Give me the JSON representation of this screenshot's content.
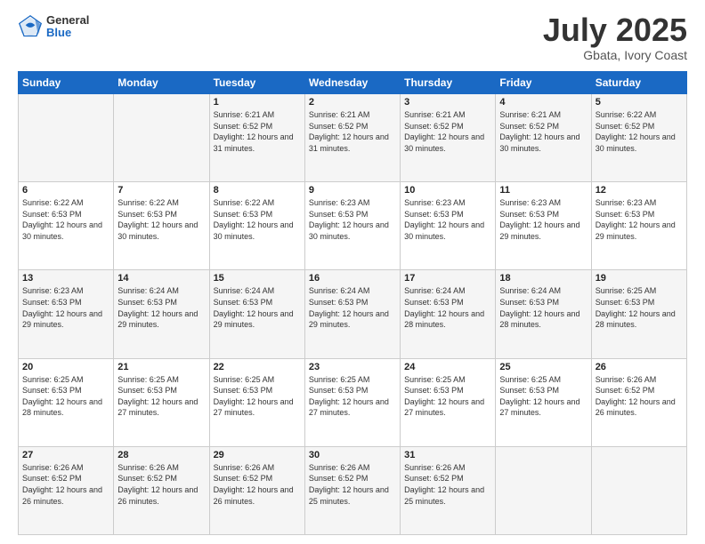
{
  "header": {
    "logo": {
      "general": "General",
      "blue": "Blue"
    },
    "title": "July 2025",
    "location": "Gbata, Ivory Coast"
  },
  "days_of_week": [
    "Sunday",
    "Monday",
    "Tuesday",
    "Wednesday",
    "Thursday",
    "Friday",
    "Saturday"
  ],
  "weeks": [
    [
      {
        "day": "",
        "sunrise": "",
        "sunset": "",
        "daylight": ""
      },
      {
        "day": "",
        "sunrise": "",
        "sunset": "",
        "daylight": ""
      },
      {
        "day": "1",
        "sunrise": "Sunrise: 6:21 AM",
        "sunset": "Sunset: 6:52 PM",
        "daylight": "Daylight: 12 hours and 31 minutes."
      },
      {
        "day": "2",
        "sunrise": "Sunrise: 6:21 AM",
        "sunset": "Sunset: 6:52 PM",
        "daylight": "Daylight: 12 hours and 31 minutes."
      },
      {
        "day": "3",
        "sunrise": "Sunrise: 6:21 AM",
        "sunset": "Sunset: 6:52 PM",
        "daylight": "Daylight: 12 hours and 30 minutes."
      },
      {
        "day": "4",
        "sunrise": "Sunrise: 6:21 AM",
        "sunset": "Sunset: 6:52 PM",
        "daylight": "Daylight: 12 hours and 30 minutes."
      },
      {
        "day": "5",
        "sunrise": "Sunrise: 6:22 AM",
        "sunset": "Sunset: 6:52 PM",
        "daylight": "Daylight: 12 hours and 30 minutes."
      }
    ],
    [
      {
        "day": "6",
        "sunrise": "Sunrise: 6:22 AM",
        "sunset": "Sunset: 6:53 PM",
        "daylight": "Daylight: 12 hours and 30 minutes."
      },
      {
        "day": "7",
        "sunrise": "Sunrise: 6:22 AM",
        "sunset": "Sunset: 6:53 PM",
        "daylight": "Daylight: 12 hours and 30 minutes."
      },
      {
        "day": "8",
        "sunrise": "Sunrise: 6:22 AM",
        "sunset": "Sunset: 6:53 PM",
        "daylight": "Daylight: 12 hours and 30 minutes."
      },
      {
        "day": "9",
        "sunrise": "Sunrise: 6:23 AM",
        "sunset": "Sunset: 6:53 PM",
        "daylight": "Daylight: 12 hours and 30 minutes."
      },
      {
        "day": "10",
        "sunrise": "Sunrise: 6:23 AM",
        "sunset": "Sunset: 6:53 PM",
        "daylight": "Daylight: 12 hours and 30 minutes."
      },
      {
        "day": "11",
        "sunrise": "Sunrise: 6:23 AM",
        "sunset": "Sunset: 6:53 PM",
        "daylight": "Daylight: 12 hours and 29 minutes."
      },
      {
        "day": "12",
        "sunrise": "Sunrise: 6:23 AM",
        "sunset": "Sunset: 6:53 PM",
        "daylight": "Daylight: 12 hours and 29 minutes."
      }
    ],
    [
      {
        "day": "13",
        "sunrise": "Sunrise: 6:23 AM",
        "sunset": "Sunset: 6:53 PM",
        "daylight": "Daylight: 12 hours and 29 minutes."
      },
      {
        "day": "14",
        "sunrise": "Sunrise: 6:24 AM",
        "sunset": "Sunset: 6:53 PM",
        "daylight": "Daylight: 12 hours and 29 minutes."
      },
      {
        "day": "15",
        "sunrise": "Sunrise: 6:24 AM",
        "sunset": "Sunset: 6:53 PM",
        "daylight": "Daylight: 12 hours and 29 minutes."
      },
      {
        "day": "16",
        "sunrise": "Sunrise: 6:24 AM",
        "sunset": "Sunset: 6:53 PM",
        "daylight": "Daylight: 12 hours and 29 minutes."
      },
      {
        "day": "17",
        "sunrise": "Sunrise: 6:24 AM",
        "sunset": "Sunset: 6:53 PM",
        "daylight": "Daylight: 12 hours and 28 minutes."
      },
      {
        "day": "18",
        "sunrise": "Sunrise: 6:24 AM",
        "sunset": "Sunset: 6:53 PM",
        "daylight": "Daylight: 12 hours and 28 minutes."
      },
      {
        "day": "19",
        "sunrise": "Sunrise: 6:25 AM",
        "sunset": "Sunset: 6:53 PM",
        "daylight": "Daylight: 12 hours and 28 minutes."
      }
    ],
    [
      {
        "day": "20",
        "sunrise": "Sunrise: 6:25 AM",
        "sunset": "Sunset: 6:53 PM",
        "daylight": "Daylight: 12 hours and 28 minutes."
      },
      {
        "day": "21",
        "sunrise": "Sunrise: 6:25 AM",
        "sunset": "Sunset: 6:53 PM",
        "daylight": "Daylight: 12 hours and 27 minutes."
      },
      {
        "day": "22",
        "sunrise": "Sunrise: 6:25 AM",
        "sunset": "Sunset: 6:53 PM",
        "daylight": "Daylight: 12 hours and 27 minutes."
      },
      {
        "day": "23",
        "sunrise": "Sunrise: 6:25 AM",
        "sunset": "Sunset: 6:53 PM",
        "daylight": "Daylight: 12 hours and 27 minutes."
      },
      {
        "day": "24",
        "sunrise": "Sunrise: 6:25 AM",
        "sunset": "Sunset: 6:53 PM",
        "daylight": "Daylight: 12 hours and 27 minutes."
      },
      {
        "day": "25",
        "sunrise": "Sunrise: 6:25 AM",
        "sunset": "Sunset: 6:53 PM",
        "daylight": "Daylight: 12 hours and 27 minutes."
      },
      {
        "day": "26",
        "sunrise": "Sunrise: 6:26 AM",
        "sunset": "Sunset: 6:52 PM",
        "daylight": "Daylight: 12 hours and 26 minutes."
      }
    ],
    [
      {
        "day": "27",
        "sunrise": "Sunrise: 6:26 AM",
        "sunset": "Sunset: 6:52 PM",
        "daylight": "Daylight: 12 hours and 26 minutes."
      },
      {
        "day": "28",
        "sunrise": "Sunrise: 6:26 AM",
        "sunset": "Sunset: 6:52 PM",
        "daylight": "Daylight: 12 hours and 26 minutes."
      },
      {
        "day": "29",
        "sunrise": "Sunrise: 6:26 AM",
        "sunset": "Sunset: 6:52 PM",
        "daylight": "Daylight: 12 hours and 26 minutes."
      },
      {
        "day": "30",
        "sunrise": "Sunrise: 6:26 AM",
        "sunset": "Sunset: 6:52 PM",
        "daylight": "Daylight: 12 hours and 25 minutes."
      },
      {
        "day": "31",
        "sunrise": "Sunrise: 6:26 AM",
        "sunset": "Sunset: 6:52 PM",
        "daylight": "Daylight: 12 hours and 25 minutes."
      },
      {
        "day": "",
        "sunrise": "",
        "sunset": "",
        "daylight": ""
      },
      {
        "day": "",
        "sunrise": "",
        "sunset": "",
        "daylight": ""
      }
    ]
  ]
}
